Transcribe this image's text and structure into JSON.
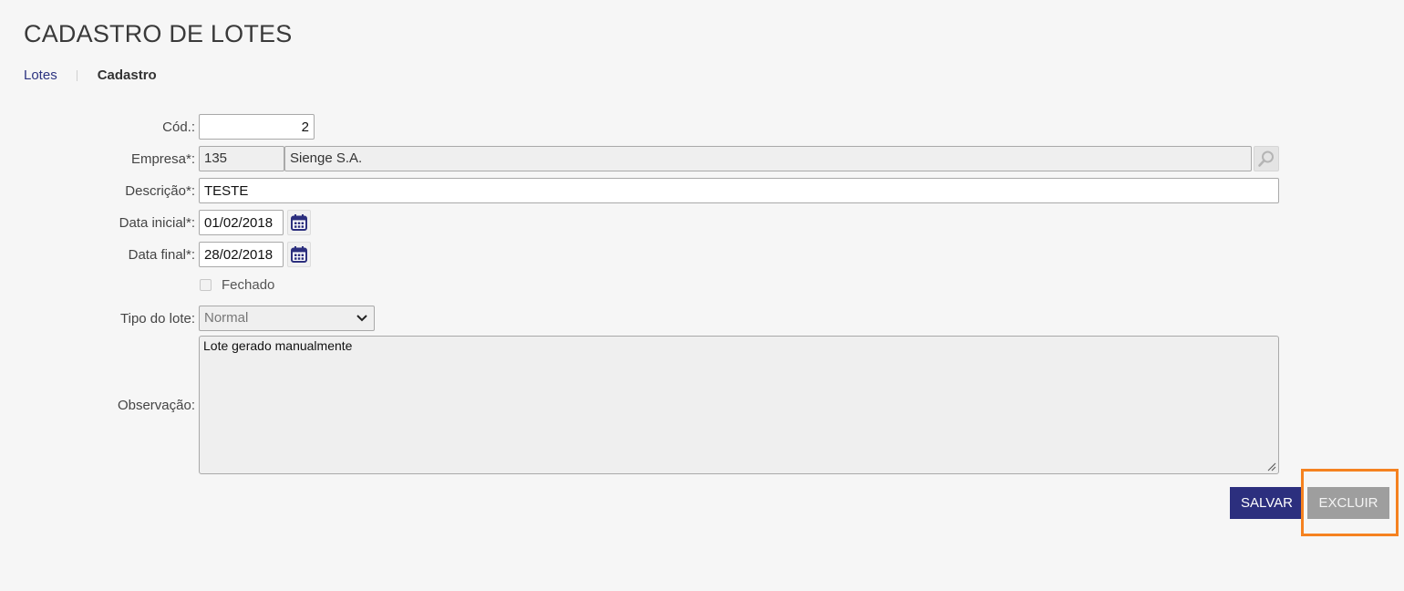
{
  "page": {
    "title": "CADASTRO DE LOTES"
  },
  "breadcrumb": {
    "parent": "Lotes",
    "current": "Cadastro"
  },
  "form": {
    "cod": {
      "label": "Cód.:",
      "value": "2"
    },
    "empresa": {
      "label": "Empresa*:",
      "code": "135",
      "name": "Sienge S.A.",
      "search_icon": "search-icon"
    },
    "descricao": {
      "label": "Descrição*:",
      "value": "TESTE"
    },
    "data_inicial": {
      "label": "Data inicial*:",
      "value": "01/02/2018",
      "icon": "calendar-icon"
    },
    "data_final": {
      "label": "Data final*:",
      "value": "28/02/2018",
      "icon": "calendar-icon"
    },
    "fechado": {
      "label": "Fechado",
      "checked": false
    },
    "tipo_lote": {
      "label": "Tipo do lote:",
      "selected": "Normal"
    },
    "observacao": {
      "label": "Observação:",
      "value": "Lote gerado manualmente"
    }
  },
  "actions": {
    "save_label": "SALVAR",
    "delete_label": "EXCLUIR"
  },
  "colors": {
    "primary": "#2c2f7e",
    "link": "#2c3380",
    "highlight": "#f58220",
    "disabled_button": "#9e9e9e",
    "background": "#f6f6f6"
  }
}
